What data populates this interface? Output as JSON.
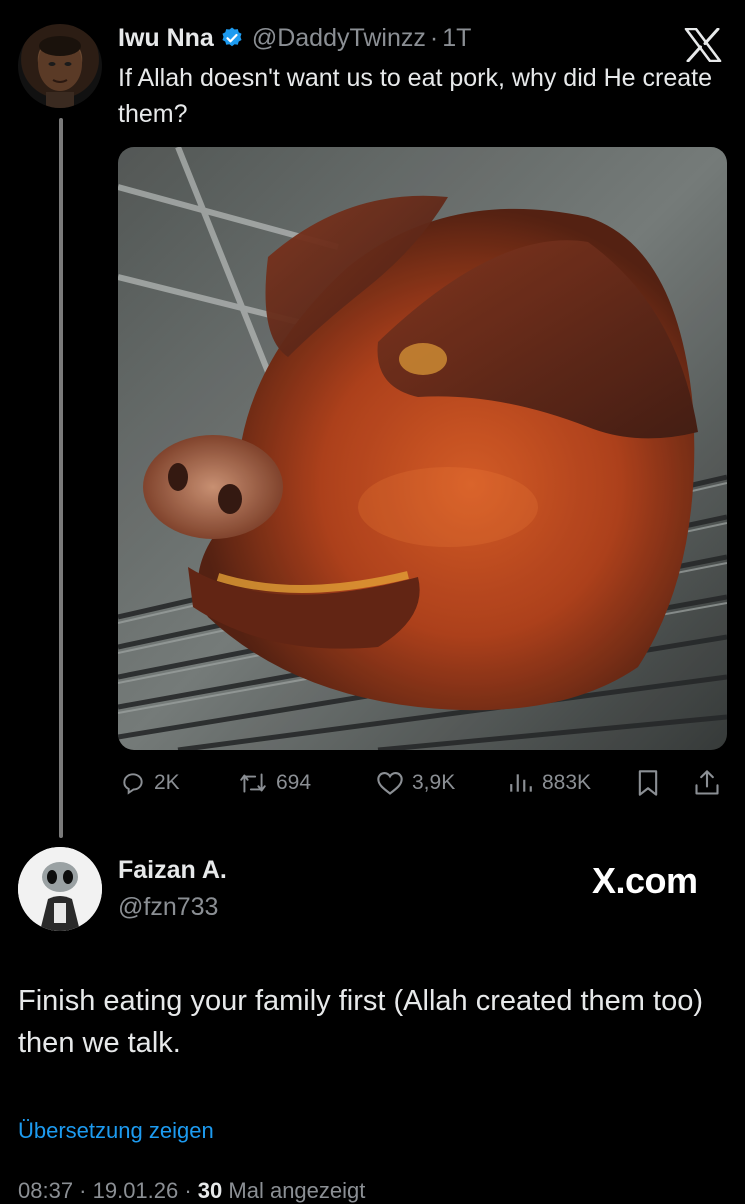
{
  "tweet": {
    "author_name": "Iwu Nna",
    "handle": "@DaddyTwinzz",
    "separator": "·",
    "time": "1T",
    "text": "If Allah doesn't want us to eat pork, why did He create them?",
    "media_icon": "roast-pig-head-photo",
    "stats": {
      "replies": "2K",
      "reposts": "694",
      "likes": "3,9K",
      "views": "883K"
    }
  },
  "quote": {
    "author_name": "Faizan A.",
    "handle": "@fzn733",
    "brand": "X.com",
    "text": "Finish eating your family first (Allah created them too) then we talk.",
    "translate_label": "Übersetzung zeigen",
    "timestamp": "08:37 · 19.01.26 · ",
    "views_count": "30",
    "views_label": " Mal angezeigt"
  },
  "colors": {
    "background": "#000000",
    "text": "#e7e9ea",
    "muted": "#8b8f94",
    "accent": "#1d9bf0"
  }
}
